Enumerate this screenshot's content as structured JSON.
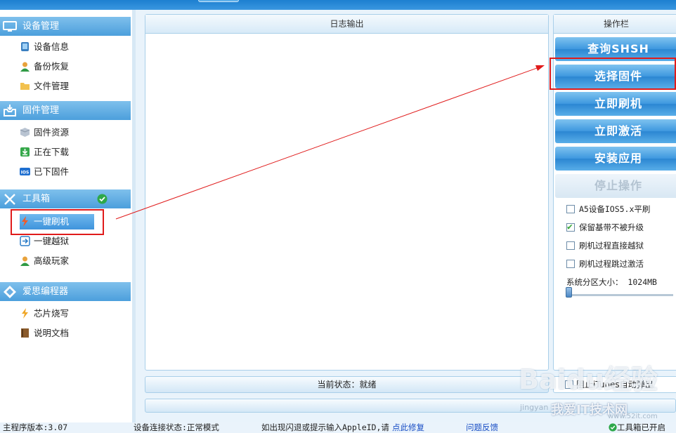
{
  "sidebar": {
    "sections": [
      {
        "title": "设备管理",
        "icon": "monitor-icon",
        "items": [
          {
            "label": "设备信息",
            "icon": "device-info-icon"
          },
          {
            "label": "备份恢复",
            "icon": "user-backup-icon"
          },
          {
            "label": "文件管理",
            "icon": "folder-icon"
          }
        ]
      },
      {
        "title": "固件管理",
        "icon": "inbox-icon",
        "items": [
          {
            "label": "固件资源",
            "icon": "box-icon"
          },
          {
            "label": "正在下载",
            "icon": "download-icon"
          },
          {
            "label": "已下固件",
            "icon": "ios-icon"
          }
        ]
      },
      {
        "title": "工具箱",
        "icon": "tools-icon",
        "items": [
          {
            "label": "一键刷机",
            "icon": "lightning-icon"
          },
          {
            "label": "一键越狱",
            "icon": "jailbreak-icon"
          },
          {
            "label": "高级玩家",
            "icon": "user-advanced-icon"
          }
        ]
      },
      {
        "title": "爱思编程器",
        "icon": "diamond-icon",
        "items": [
          {
            "label": "芯片烧写",
            "icon": "lightning-icon"
          },
          {
            "label": "说明文档",
            "icon": "book-icon"
          }
        ]
      }
    ],
    "active_item": "一键刷机"
  },
  "log_panel": {
    "title": "日志输出"
  },
  "status": {
    "text": "当前状态：就绪"
  },
  "ops_panel": {
    "title": "操作栏",
    "buttons": [
      {
        "label": "查询SHSH",
        "enabled": true
      },
      {
        "label": "选择固件",
        "enabled": true
      },
      {
        "label": "立即刷机",
        "enabled": true
      },
      {
        "label": "立即激活",
        "enabled": true
      },
      {
        "label": "安装应用",
        "enabled": true
      },
      {
        "label": "停止操作",
        "enabled": false
      }
    ],
    "options": [
      {
        "label": "A5设备IOS5.x平刷",
        "checked": false
      },
      {
        "label": "保留基带不被升级",
        "checked": true
      },
      {
        "label": "刷机过程直接越狱",
        "checked": false
      },
      {
        "label": "刷机过程跳过激活",
        "checked": false
      }
    ],
    "partition_label": "系统分区大小： 1024MB",
    "partition_fraction": 0.0
  },
  "itunes": {
    "label": "阻止iTunes自动弹出",
    "checked": false
  },
  "footer": {
    "version": "主程序版本:3.07",
    "connection": "设备连接状态:正常模式",
    "hint": "如出现闪退或提示输入AppleID,请",
    "fix_link": "点此修复",
    "feedback_link": "问题反馈",
    "toolbox_status": "工具箱已开启"
  },
  "watermark": {
    "brand": "Baidu经验",
    "site": "我爱IT技术网",
    "url": "jingyan",
    "url2": "www.52it.com"
  },
  "colors": {
    "accent": "#3d97df",
    "highlight": "#e01b1b",
    "check": "#3aa83a"
  }
}
